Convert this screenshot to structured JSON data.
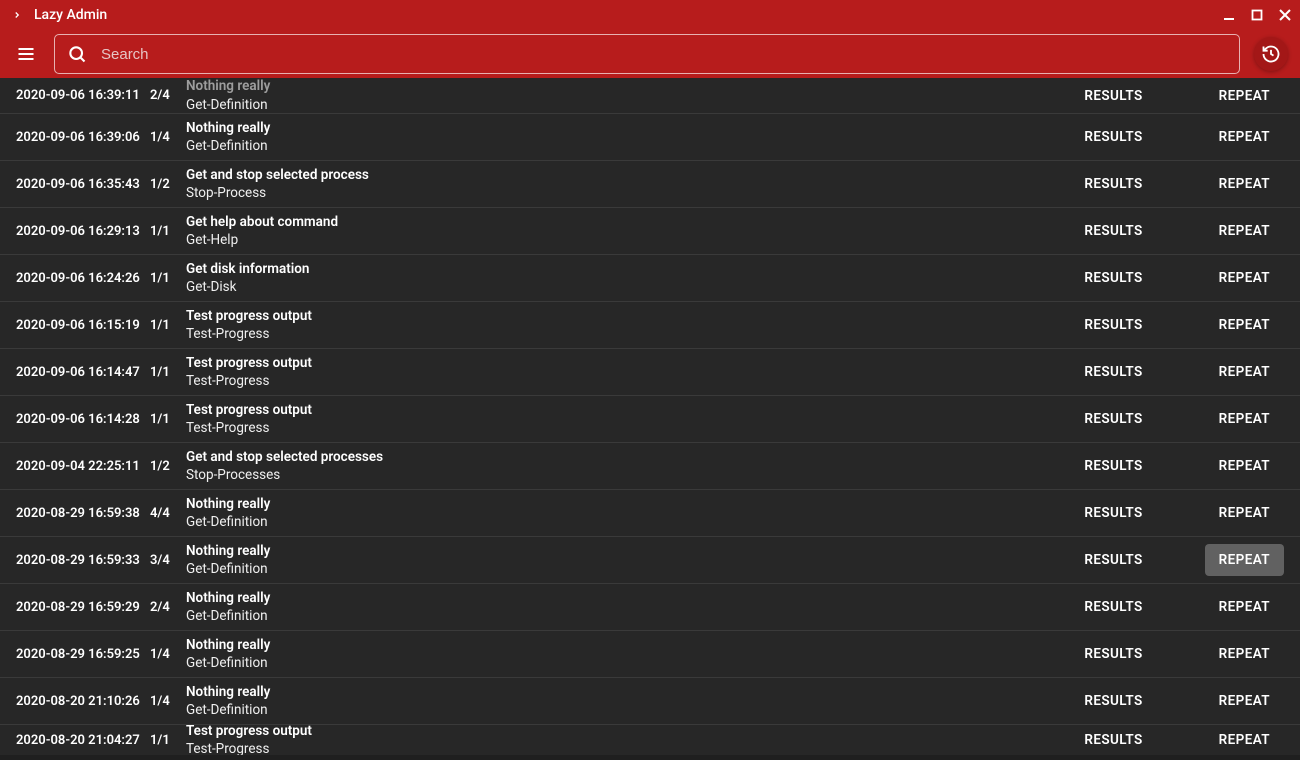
{
  "app": {
    "title": "Lazy Admin"
  },
  "search": {
    "placeholder": "Search"
  },
  "buttons": {
    "results": "RESULTS",
    "repeat": "REPEAT"
  },
  "rows": [
    {
      "ts": "2020-09-06 16:39:11",
      "count": "2/4",
      "title": "Nothing really",
      "sub": "Get-Definition",
      "firstClipped": true
    },
    {
      "ts": "2020-09-06 16:39:06",
      "count": "1/4",
      "title": "Nothing really",
      "sub": "Get-Definition"
    },
    {
      "ts": "2020-09-06 16:35:43",
      "count": "1/2",
      "title": "Get and stop selected process",
      "sub": "Stop-Process"
    },
    {
      "ts": "2020-09-06 16:29:13",
      "count": "1/1",
      "title": "Get help about command",
      "sub": "Get-Help"
    },
    {
      "ts": "2020-09-06 16:24:26",
      "count": "1/1",
      "title": "Get disk information",
      "sub": "Get-Disk"
    },
    {
      "ts": "2020-09-06 16:15:19",
      "count": "1/1",
      "title": "Test progress output",
      "sub": "Test-Progress"
    },
    {
      "ts": "2020-09-06 16:14:47",
      "count": "1/1",
      "title": "Test progress output",
      "sub": "Test-Progress"
    },
    {
      "ts": "2020-09-06 16:14:28",
      "count": "1/1",
      "title": "Test progress output",
      "sub": "Test-Progress"
    },
    {
      "ts": "2020-09-04 22:25:11",
      "count": "1/2",
      "title": "Get and stop selected processes",
      "sub": "Stop-Processes"
    },
    {
      "ts": "2020-08-29 16:59:38",
      "count": "4/4",
      "title": "Nothing really",
      "sub": "Get-Definition"
    },
    {
      "ts": "2020-08-29 16:59:33",
      "count": "3/4",
      "title": "Nothing really",
      "sub": "Get-Definition",
      "repeatHover": true
    },
    {
      "ts": "2020-08-29 16:59:29",
      "count": "2/4",
      "title": "Nothing really",
      "sub": "Get-Definition"
    },
    {
      "ts": "2020-08-29 16:59:25",
      "count": "1/4",
      "title": "Nothing really",
      "sub": "Get-Definition"
    },
    {
      "ts": "2020-08-20 21:10:26",
      "count": "1/4",
      "title": "Nothing really",
      "sub": "Get-Definition"
    },
    {
      "ts": "2020-08-20 21:04:27",
      "count": "1/1",
      "title": "Test progress output",
      "sub": "Test-Progress",
      "lastClipped": true
    }
  ]
}
